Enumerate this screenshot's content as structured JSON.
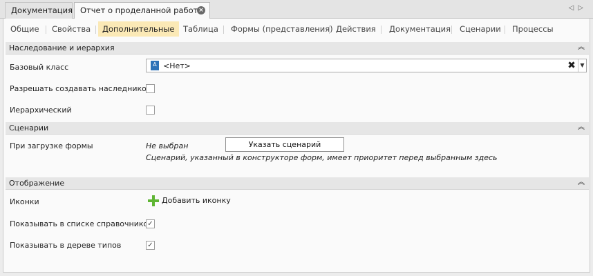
{
  "document_tabs": [
    {
      "label": "Документация"
    },
    {
      "label": "Отчет о проделанной работе"
    }
  ],
  "nav": {
    "prev": "◁",
    "next": "▷"
  },
  "section_tabs": [
    {
      "label": "Общие"
    },
    {
      "label": "Свойства"
    },
    {
      "label": "Дополнительные",
      "active": true
    },
    {
      "label": "Таблица"
    },
    {
      "label": "Формы (представления)"
    },
    {
      "label": "Действия"
    },
    {
      "label": "Документация"
    },
    {
      "label": "Сценарии"
    },
    {
      "label": "Процессы"
    }
  ],
  "groups": {
    "inheritance": {
      "title": "Наследование и иерархия",
      "base_class_label": "Базовый класс",
      "base_class_value": "<Нет>",
      "allow_inherit_label": "Разрешать создавать наследников",
      "allow_inherit_checked": false,
      "hierarchical_label": "Иерархический",
      "hierarchical_checked": false
    },
    "scenarios": {
      "title": "Сценарии",
      "on_load_label": "При загрузке формы",
      "on_load_value": "Не выбран",
      "button_label": "Указать сценарий",
      "note": "Сценарий, указанный в конструкторе форм, имеет приоритет перед выбранным здесь"
    },
    "display": {
      "title": "Отображение",
      "icons_label": "Иконки",
      "add_icon_label": "Добавить иконку",
      "show_in_catalog_list_label": "Показывать в списке справочников",
      "show_in_catalog_list_checked": true,
      "show_in_type_tree_label": "Показывать в дереве типов",
      "show_in_type_tree_checked": true
    }
  },
  "colors": {
    "active_tab": "#fbe9b6",
    "add_icon": "#5fb534",
    "class_icon": "#2d72b8"
  }
}
